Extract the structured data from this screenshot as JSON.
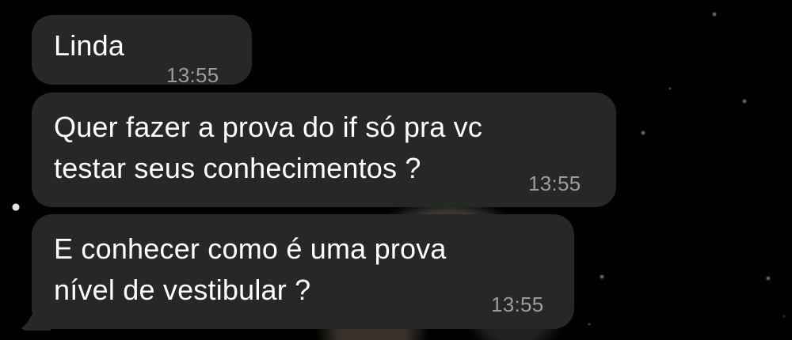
{
  "wallpaper": {
    "background_color": "#000000"
  },
  "chat": {
    "bubble_color": "#262727",
    "text_color": "#ffffff",
    "time_color": "#9c9c9c",
    "messages": [
      {
        "text": "Linda",
        "time": "13:55"
      },
      {
        "text": "Quer fazer a prova do if só pra vc\ntestar seus conhecimentos ?",
        "time": "13:55"
      },
      {
        "text": "E conhecer como é uma prova\nnível de vestibular ?",
        "time": "13:55"
      }
    ]
  }
}
